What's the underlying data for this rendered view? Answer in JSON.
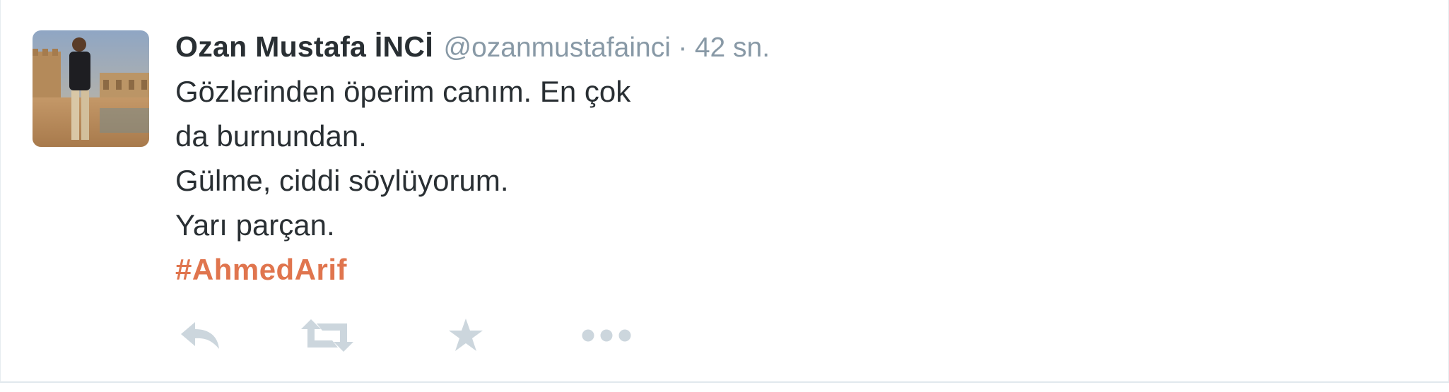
{
  "tweet": {
    "fullname": "Ozan Mustafa İNCİ",
    "username": "@ozanmustafainci",
    "separator": "·",
    "time": "42 sn.",
    "text_lines": [
      "Gözlerinden öperim canım. En çok",
      "da burnundan.",
      "Gülme, ciddi söylüyorum.",
      "Yarı parçan."
    ],
    "hashtag": "#AhmedArif"
  },
  "actions": {
    "reply_icon": "reply-icon",
    "retweet_icon": "retweet-icon",
    "favorite_icon": "star-icon",
    "more_icon": "more-dots-icon"
  },
  "colors": {
    "name": "#292f33",
    "meta": "#8899a6",
    "hashtag": "#e0754e",
    "action_icon": "#ccd6dd",
    "border": "#e1e8ed"
  }
}
